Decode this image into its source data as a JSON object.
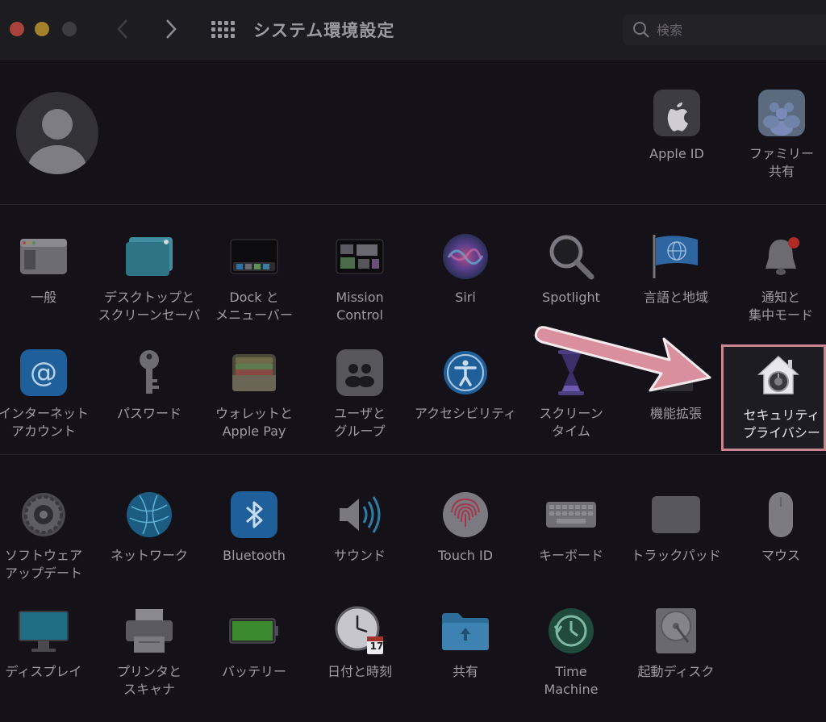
{
  "window": {
    "title": "システム環境設定"
  },
  "search": {
    "placeholder": "検索"
  },
  "account": [
    {
      "label": "Apple ID",
      "icon": "apple-id-icon"
    },
    {
      "label": "ファミリー\n共有",
      "icon": "family-sharing-icon"
    }
  ],
  "row1": [
    {
      "label": "一般",
      "icon": "general-icon"
    },
    {
      "label": "デスクトップと\nスクリーンセーバ",
      "icon": "desktop-icon"
    },
    {
      "label": "Dock と\nメニューバー",
      "icon": "dock-icon"
    },
    {
      "label": "Mission\nControl",
      "icon": "mission-control-icon"
    },
    {
      "label": "Siri",
      "icon": "siri-icon"
    },
    {
      "label": "Spotlight",
      "icon": "spotlight-icon"
    },
    {
      "label": "言語と地域",
      "icon": "language-icon"
    },
    {
      "label": "通知と\n集中モード",
      "icon": "notification-icon"
    }
  ],
  "row2": [
    {
      "label": "インターネット\nアカウント",
      "icon": "internet-accounts-icon"
    },
    {
      "label": "パスワード",
      "icon": "key-icon"
    },
    {
      "label": "ウォレットと\nApple Pay",
      "icon": "wallet-icon"
    },
    {
      "label": "ユーザと\nグループ",
      "icon": "users-icon"
    },
    {
      "label": "アクセシビリティ",
      "icon": "accessibility-icon"
    },
    {
      "label": "スクリーン\nタイム",
      "icon": "hourglass-icon"
    },
    {
      "label": "機能拡張",
      "icon": "extensions-icon"
    }
  ],
  "highlight": {
    "label": "セキュリティ\nプライバシー",
    "icon": "security-house-icon"
  },
  "row3": [
    {
      "label": "ソフトウェア\nアップデート",
      "icon": "gear-icon"
    },
    {
      "label": "ネットワーク",
      "icon": "globe-icon"
    },
    {
      "label": "Bluetooth",
      "icon": "bluetooth-icon"
    },
    {
      "label": "サウンド",
      "icon": "speaker-icon"
    },
    {
      "label": "Touch ID",
      "icon": "fingerprint-icon"
    },
    {
      "label": "キーボード",
      "icon": "keyboard-icon"
    },
    {
      "label": "トラックパッド",
      "icon": "trackpad-icon"
    },
    {
      "label": "マウス",
      "icon": "mouse-icon"
    }
  ],
  "row4": [
    {
      "label": "ディスプレイ",
      "icon": "display-icon"
    },
    {
      "label": "プリンタと\nスキャナ",
      "icon": "printer-icon"
    },
    {
      "label": "バッテリー",
      "icon": "battery-icon"
    },
    {
      "label": "日付と時刻",
      "icon": "clock-icon"
    },
    {
      "label": "共有",
      "icon": "sharing-folder-icon"
    },
    {
      "label": "Time\nMachine",
      "icon": "time-machine-icon"
    },
    {
      "label": "起動ディスク",
      "icon": "disk-icon"
    }
  ],
  "calendar_day": "17",
  "colors": {
    "accent_highlight": "#c98592",
    "arrow": "#d98f9e"
  }
}
